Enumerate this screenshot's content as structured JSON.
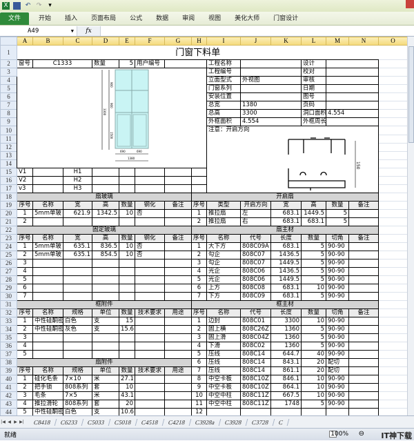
{
  "app": {
    "ribbon_tabs": [
      "文件",
      "开始",
      "插入",
      "页面布局",
      "公式",
      "数据",
      "审阅",
      "视图",
      "美化大师",
      "门窗设计"
    ],
    "name_box": "A49",
    "fx_label": "fx"
  },
  "columns": [
    "A",
    "B",
    "C",
    "D",
    "E",
    "F",
    "G",
    "H",
    "I",
    "J",
    "K",
    "L",
    "M",
    "N",
    "O"
  ],
  "sheet": {
    "title": "门窗下料单",
    "row2": {
      "window_no_label": "窗号",
      "window_no": "C1333",
      "qty_label": "数量",
      "qty": "5",
      "user_no_label": "用户编号",
      "user_no": ""
    },
    "info_rows": [
      {
        "label": "工程名称",
        "value": "",
        "label2": "设计",
        "value2": ""
      },
      {
        "label": "工程编号",
        "value": "",
        "label2": "校对",
        "value2": ""
      },
      {
        "label": "立面型式",
        "value": "外视图",
        "label2": "审核",
        "value2": ""
      },
      {
        "label": "门窗系列",
        "value": "",
        "label2": "日期",
        "value2": ""
      },
      {
        "label": "安装位置",
        "value": "",
        "label2": "图号",
        "value2": ""
      },
      {
        "label": "总宽",
        "value": "1380",
        "label2": "页码",
        "value2": ""
      },
      {
        "label": "总高",
        "value": "3300",
        "label2": "洞口面积",
        "value2": "4.554"
      },
      {
        "label": "外框面积",
        "value": "4.554",
        "label2": "外框周长",
        "value2": ""
      }
    ],
    "note": "注意：开启方向",
    "profile_dim": "150",
    "drawing": {
      "dims_v": [
        "900",
        "900",
        "1500"
      ],
      "total_h": "3300",
      "dims_w": [
        "690",
        "690"
      ],
      "total_w": "1380"
    },
    "vh_rows": [
      {
        "v": "V1",
        "h": "H1"
      },
      {
        "v": "V2",
        "h": "H2"
      },
      {
        "v": "v3",
        "h": "H3"
      }
    ],
    "lower": [
      {
        "left_title": "扇玻璃",
        "right_title": "开启扇"
      },
      {
        "left": [
          "序号",
          "名称",
          "宽",
          "高",
          "数量",
          "钢化",
          "备注"
        ],
        "left_header": true,
        "right": [
          "序号",
          "类型",
          "开启方向",
          "宽",
          "高",
          "数量",
          "备注"
        ],
        "right_header": true
      },
      {
        "left": [
          "1",
          "5mm单玻",
          "621.9",
          "1342.5",
          "10",
          "否",
          ""
        ],
        "right": [
          "1",
          "推拉扇",
          "左",
          "683.1",
          "1449.5",
          "5",
          ""
        ]
      },
      {
        "left": [
          "2",
          "",
          "",
          "",
          "",
          "",
          ""
        ],
        "right": [
          "2",
          "推拉扇",
          "右",
          "683.1",
          "683.1",
          "5",
          ""
        ]
      },
      {
        "left_title": "固定玻璃",
        "right_title": "扇主材"
      },
      {
        "left": [
          "序号",
          "名称",
          "宽",
          "高",
          "数量",
          "钢化",
          "备注"
        ],
        "left_header": true,
        "right": [
          "序号",
          "名称",
          "代号",
          "长度",
          "数量",
          "切角",
          "备注"
        ],
        "right_header": true
      },
      {
        "left": [
          "1",
          "5mm单玻",
          "635.1",
          "836.5",
          "10",
          "否",
          ""
        ],
        "right": [
          "1",
          "大下方",
          "808C09A",
          "683.1",
          "5",
          "90-90",
          ""
        ]
      },
      {
        "left": [
          "2",
          "5mm单玻",
          "635.1",
          "854.5",
          "10",
          "否",
          ""
        ],
        "right": [
          "2",
          "勾企",
          "808C07",
          "1436.5",
          "5",
          "90-90",
          ""
        ]
      },
      {
        "left": [
          "3",
          "",
          "",
          "",
          "",
          "",
          ""
        ],
        "right": [
          "3",
          "勾企",
          "808C07",
          "1449.5",
          "5",
          "90-90",
          ""
        ]
      },
      {
        "left": [
          "4",
          "",
          "",
          "",
          "",
          "",
          ""
        ],
        "right": [
          "4",
          "光企",
          "808C06",
          "1436.5",
          "5",
          "90-90",
          ""
        ]
      },
      {
        "left": [
          "5",
          "",
          "",
          "",
          "",
          "",
          ""
        ],
        "right": [
          "5",
          "光企",
          "808C06",
          "1449.5",
          "5",
          "90-90",
          ""
        ]
      },
      {
        "left": [
          "6",
          "",
          "",
          "",
          "",
          "",
          ""
        ],
        "right": [
          "6",
          "上方",
          "808C08",
          "683.1",
          "10",
          "90-90",
          ""
        ]
      },
      {
        "left": [
          "7",
          "",
          "",
          "",
          "",
          "",
          ""
        ],
        "right": [
          "7",
          "下方",
          "808C09",
          "683.1",
          "5",
          "90-90",
          ""
        ]
      },
      {
        "left_title": "框附件",
        "right_title": "框主材"
      },
      {
        "left": [
          "序号",
          "名称",
          "规格",
          "单位",
          "数量",
          "技术要求",
          "用途"
        ],
        "left_header": true,
        "right": [
          "序号",
          "名称",
          "代号",
          "长度",
          "数量",
          "切角",
          "备注"
        ],
        "right_header": true
      },
      {
        "left": [
          "1",
          "中性硅酮密",
          "白色",
          "支",
          "15",
          "",
          ""
        ],
        "right": [
          "1",
          "边封",
          "808C01",
          "3300",
          "10",
          "90-90",
          ""
        ]
      },
      {
        "left": [
          "2",
          "中性硅酮密",
          "灰色",
          "支",
          "15.6",
          "",
          ""
        ],
        "right": [
          "2",
          "固上横",
          "808C26Z",
          "1360",
          "5",
          "90-90",
          ""
        ]
      },
      {
        "left": [
          "3",
          "",
          "",
          "",
          "",
          "",
          ""
        ],
        "right": [
          "3",
          "固上滑",
          "808C04Z",
          "1360",
          "5",
          "90-90",
          ""
        ]
      },
      {
        "left": [
          "4",
          "",
          "",
          "",
          "",
          "",
          ""
        ],
        "right": [
          "4",
          "下滑",
          "808C02",
          "1360",
          "5",
          "90-90",
          ""
        ]
      },
      {
        "left": [
          "5",
          "",
          "",
          "",
          "",
          "",
          ""
        ],
        "right": [
          "5",
          "压线",
          "808C14",
          "644.7",
          "40",
          "90-90",
          ""
        ]
      },
      {
        "left_title": "扇附件",
        "right": [
          "6",
          "压线",
          "808C14",
          "843.1",
          "20",
          "配切",
          ""
        ]
      },
      {
        "left": [
          "序号",
          "名称",
          "规格",
          "单位",
          "数量",
          "技术要求",
          "用途"
        ],
        "left_header": true,
        "right": [
          "7",
          "压线",
          "808C14",
          "861.1",
          "20",
          "配切",
          ""
        ]
      },
      {
        "left": [
          "1",
          "硅化毛条",
          "7×10",
          "米",
          "27.1",
          "",
          ""
        ],
        "right": [
          "8",
          "中空卡板",
          "808C10Z",
          "846.1",
          "10",
          "90-90",
          ""
        ]
      },
      {
        "left": [
          "2",
          "把手锁",
          "808系列",
          "套",
          "10",
          "",
          ""
        ],
        "right": [
          "9",
          "中空卡板",
          "808C10Z",
          "864.1",
          "10",
          "90-90",
          ""
        ]
      },
      {
        "left": [
          "3",
          "毛条",
          "7×5",
          "米",
          "43.1",
          "",
          ""
        ],
        "right": [
          "10",
          "中空中柱",
          "808C11Z",
          "667.5",
          "10",
          "90-90",
          ""
        ]
      },
      {
        "left": [
          "4",
          "推拉滑轮",
          "808系列",
          "套",
          "20",
          "",
          ""
        ],
        "right": [
          "11",
          "中空中柱",
          "808C11Z",
          "1748",
          "5",
          "90-90",
          ""
        ]
      },
      {
        "left": [
          "5",
          "中性硅酮密",
          "白色",
          "支",
          "10.6",
          "",
          ""
        ],
        "right": [
          "12",
          "",
          "",
          "",
          "",
          "",
          ""
        ]
      }
    ]
  },
  "sheet_tabs": [
    "C8418",
    "C6233",
    "C5033",
    "C5018",
    "C4518",
    "C4218",
    "C3928a",
    "C3928",
    "C3728",
    "C"
  ],
  "status": {
    "ready": "就绪",
    "zoom": "100%"
  },
  "watermark": "IT神下载"
}
